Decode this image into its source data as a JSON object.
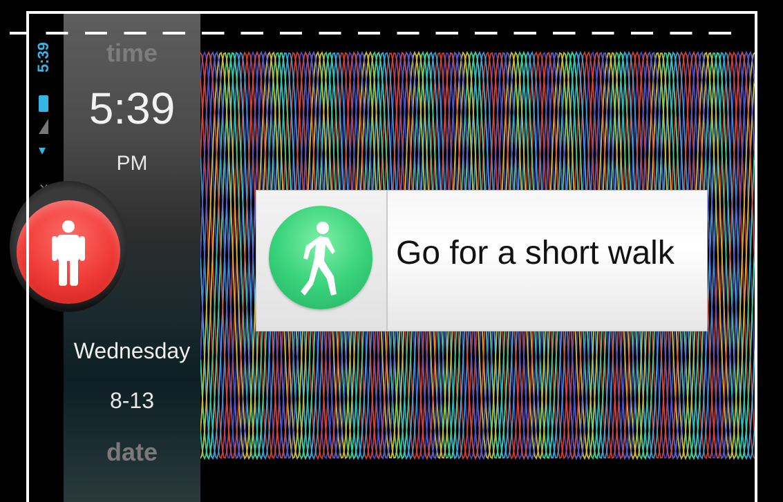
{
  "status_bar": {
    "time": "5:39",
    "icons": [
      "battery-icon",
      "signal-icon",
      "wifi-icon",
      "silent-icon"
    ],
    "accent_color": "#35b5e5"
  },
  "side_panel": {
    "time_heading": "time",
    "clock": "5:39",
    "ampm": "PM",
    "status_icon": "standing-person-icon",
    "status_color": "#ef3a36",
    "day": "Wednesday",
    "date": "8-13",
    "date_heading": "date"
  },
  "notification": {
    "icon": "walking-person-icon",
    "icon_color": "#3bd37c",
    "message": "Go for a short walk"
  },
  "wave_colors": [
    "#3aa9e0",
    "#d9eef5",
    "#2fd08a",
    "#e0b52a",
    "#4b4fd6",
    "#e0453a"
  ]
}
